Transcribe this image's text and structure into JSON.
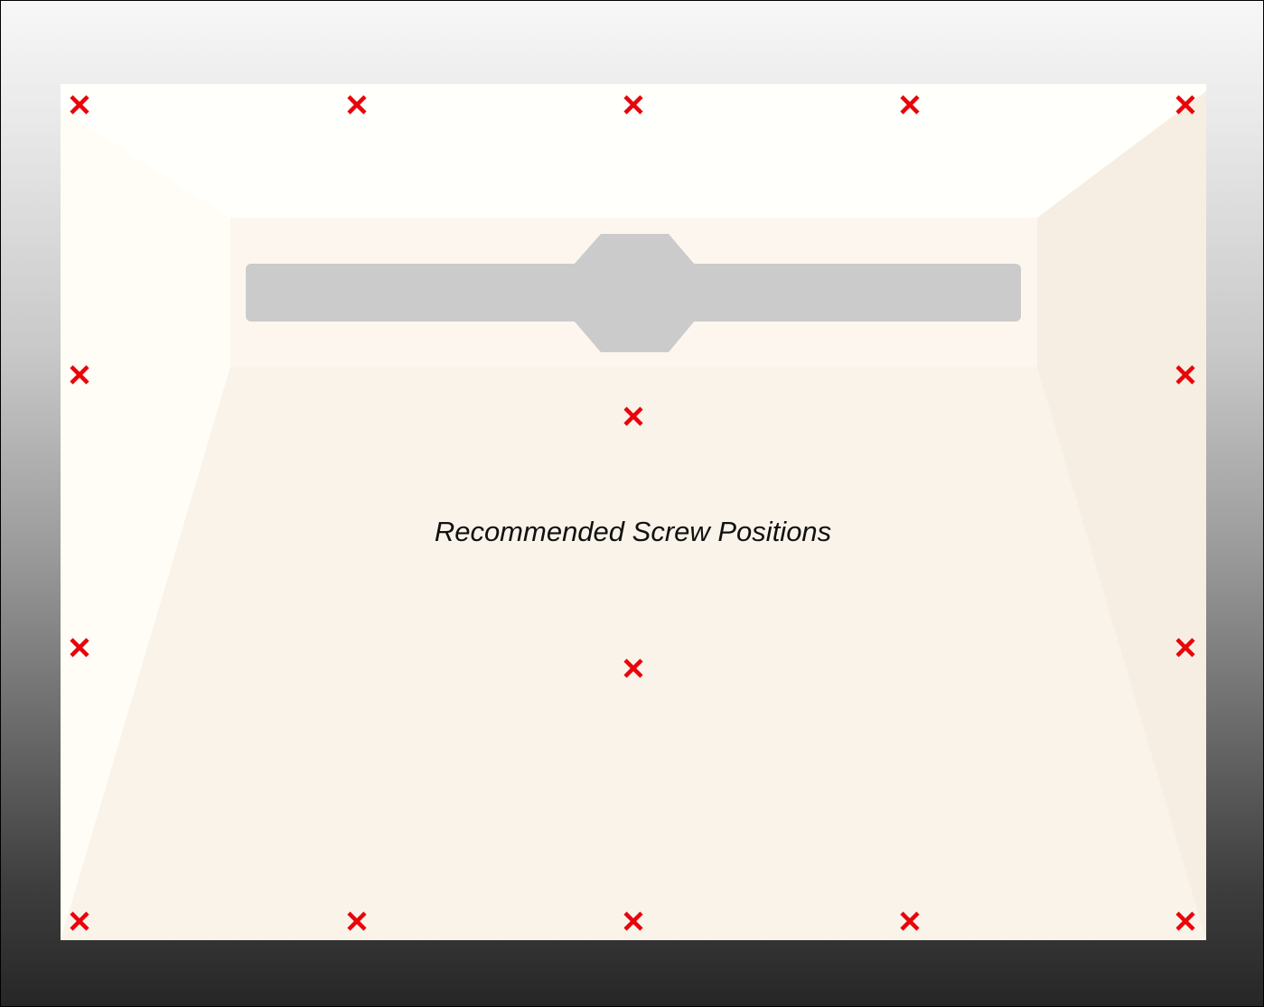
{
  "caption": "Recommended Screw Positions",
  "colors": {
    "screw_mark": "#e8050a",
    "back_wall": "#f9f3ea",
    "left_wall": "#fffdf7",
    "right_wall": "#f6eee2",
    "ceiling": "#fffffb",
    "bracket": "#cbcbcb"
  },
  "icons": {
    "screw_mark": "cross-mark"
  },
  "screw_count": 16
}
